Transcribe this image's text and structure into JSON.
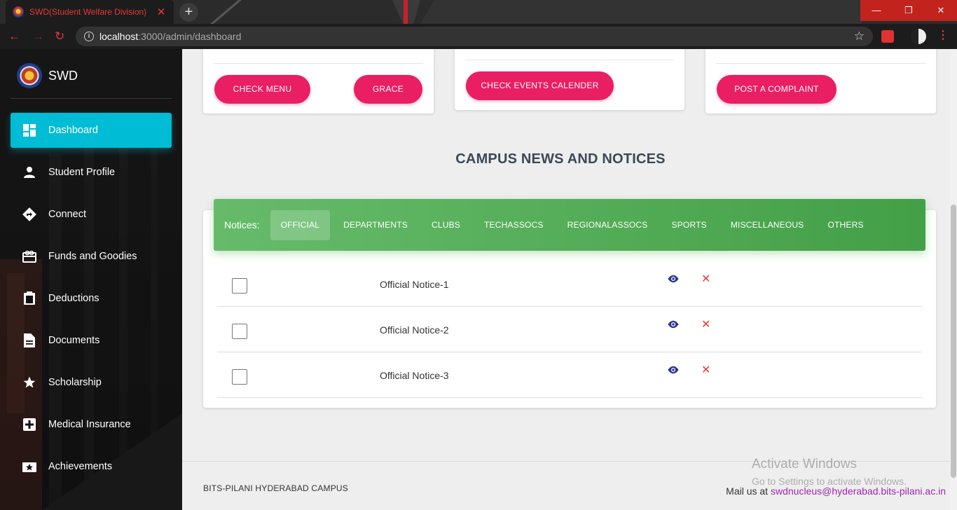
{
  "browser": {
    "tab_title": "SWD(Student Welfare Division)",
    "url_host": "localhost",
    "url_path": ":3000/admin/dashboard"
  },
  "sidebar": {
    "brand": "SWD",
    "items": [
      {
        "label": "Dashboard",
        "icon": "dashboard-icon",
        "active": true
      },
      {
        "label": "Student Profile",
        "icon": "person-icon"
      },
      {
        "label": "Connect",
        "icon": "directions-icon"
      },
      {
        "label": "Funds and Goodies",
        "icon": "gift-card-icon"
      },
      {
        "label": "Deductions",
        "icon": "clipboard-icon"
      },
      {
        "label": "Documents",
        "icon": "document-icon"
      },
      {
        "label": "Scholarship",
        "icon": "star-icon"
      },
      {
        "label": "Medical Insurance",
        "icon": "medical-plus-icon"
      },
      {
        "label": "Achievements",
        "icon": "award-icon"
      }
    ]
  },
  "cards": {
    "menu_button": "CHECK MENU",
    "grace_button": "GRACE",
    "events_button": "CHECK EVENTS CALENDER",
    "complaint_button": "POST A COMPLAINT"
  },
  "news": {
    "title": "CAMPUS NEWS AND NOTICES",
    "tabs_label": "Notices:",
    "tabs": [
      "OFFICIAL",
      "DEPARTMENTS",
      "CLUBS",
      "TECHASSOCS",
      "REGIONALASSOCS",
      "SPORTS",
      "MISCELLANEOUS",
      "OTHERS"
    ],
    "active_tab": "OFFICIAL",
    "notices": [
      "Official Notice-1",
      "Official Notice-2",
      "Official Notice-3"
    ]
  },
  "footer": {
    "campus": "BITS-PILANI HYDERABAD CAMPUS",
    "mail_prefix": "Mail us at",
    "mail_address": "swdnucleus@hyderabad.bits-pilani.ac.in"
  },
  "watermark": {
    "title": "Activate Windows",
    "subtitle": "Go to Settings to activate Windows."
  },
  "colors": {
    "accent_pink": "#e91e63",
    "active_cyan": "#00bcd4",
    "tabs_green": "#4caf50",
    "chrome_red": "#e53935"
  }
}
